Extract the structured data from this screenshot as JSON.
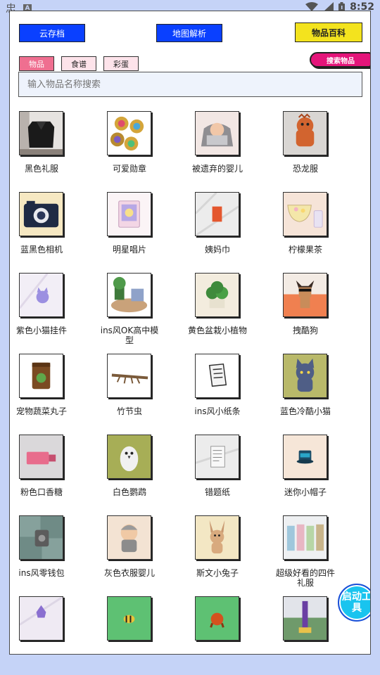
{
  "status_bar": {
    "app_glyph": "忠",
    "a_badge": "A",
    "time": "8:52"
  },
  "header": {
    "cloud_save": "云存档",
    "map_parse": "地图解析",
    "encyclopedia": "物品百科"
  },
  "tabs": [
    {
      "label": "物品",
      "active": true
    },
    {
      "label": "食谱",
      "active": false
    },
    {
      "label": "彩蛋",
      "active": false
    }
  ],
  "search_tag": "搜索物品",
  "search": {
    "placeholder": "输入物品名称搜索"
  },
  "items": [
    {
      "name": "黑色礼服",
      "icon": "black-dress-icon"
    },
    {
      "name": "可爱勋章",
      "icon": "badges-icon"
    },
    {
      "name": "被遗弃的婴儿",
      "icon": "abandoned-baby-icon"
    },
    {
      "name": "恐龙服",
      "icon": "dino-costume-icon"
    },
    {
      "name": "蓝黑色相机",
      "icon": "camera-icon"
    },
    {
      "name": "明星唱片",
      "icon": "star-record-icon"
    },
    {
      "name": "姨妈巾",
      "icon": "pad-icon"
    },
    {
      "name": "柠檬果茶",
      "icon": "lemon-tea-icon"
    },
    {
      "name": "紫色小猫挂件",
      "icon": "purple-cat-charm-icon"
    },
    {
      "name": "ins风OK高中模型",
      "icon": "school-model-icon"
    },
    {
      "name": "黄色盆栽小植物",
      "icon": "potted-plant-icon"
    },
    {
      "name": "拽酷狗",
      "icon": "cool-dog-icon"
    },
    {
      "name": "宠物蔬菜丸子",
      "icon": "pet-food-icon"
    },
    {
      "name": "竹节虫",
      "icon": "stick-insect-icon"
    },
    {
      "name": "ins风小纸条",
      "icon": "paper-note-icon"
    },
    {
      "name": "蓝色冷酷小猫",
      "icon": "blue-cat-icon"
    },
    {
      "name": "粉色口香糖",
      "icon": "pink-gum-icon"
    },
    {
      "name": "白色鹦鹉",
      "icon": "white-parrot-icon"
    },
    {
      "name": "错题纸",
      "icon": "wrong-question-paper-icon"
    },
    {
      "name": "迷你小帽子",
      "icon": "mini-hat-icon"
    },
    {
      "name": "ins风零钱包",
      "icon": "coin-purse-icon"
    },
    {
      "name": "灰色衣服婴儿",
      "icon": "grey-baby-icon"
    },
    {
      "name": "斯文小兔子",
      "icon": "gentle-bunny-icon"
    },
    {
      "name": "超级好看的四件礼服",
      "icon": "four-dresses-icon"
    },
    {
      "name": "",
      "icon": "purple-gem-icon"
    },
    {
      "name": "",
      "icon": "bee-icon"
    },
    {
      "name": "",
      "icon": "orange-bird-icon"
    },
    {
      "name": "",
      "icon": "purple-lamp-icon"
    }
  ],
  "fab": "启动工具"
}
